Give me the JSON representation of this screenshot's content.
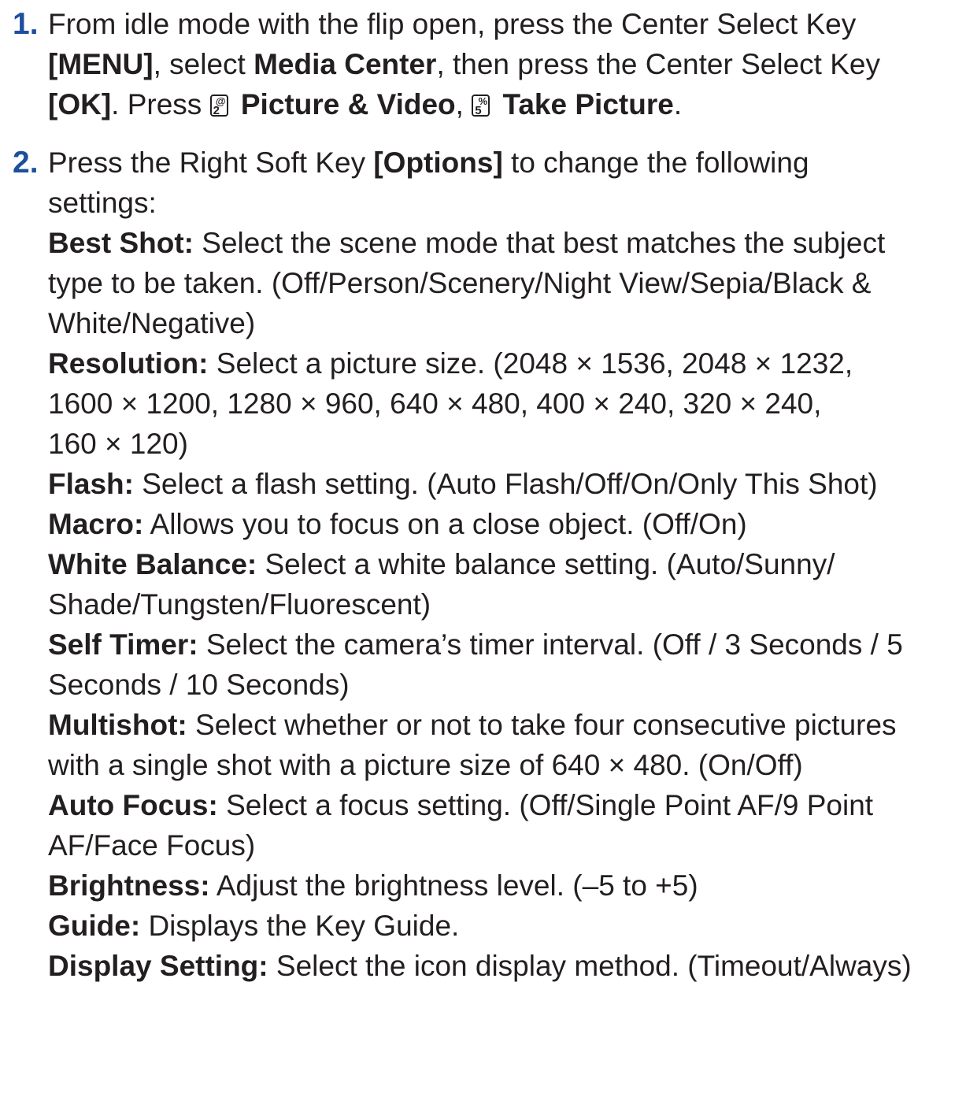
{
  "step1": {
    "number": "1.",
    "l1": "From idle mode with the flip open, press the Center Select Key",
    "l2_b1": "[MENU]",
    "l2_t1": ", select ",
    "l2_b2": "Media Center",
    "l2_t2": ", then press the Center Select Key",
    "l3_b1": "[OK]",
    "l3_t1": ". Press ",
    "key1": {
      "num": "2",
      "sym": "@",
      "icon": "key-2-icon"
    },
    "l3_b2": "Picture & Video",
    "l3_t2": ", ",
    "key2": {
      "num": "5",
      "sym": "%",
      "icon": "key-5-icon"
    },
    "l3_b3": "Take Picture",
    "l3_t3": "."
  },
  "step2": {
    "number": "2.",
    "intro_t1": "Press the Right Soft Key ",
    "intro_b1": "[Options]",
    "intro_t2": " to change the following",
    "intro_t3": "settings:",
    "best_shot": {
      "label": "Best Shot:",
      "l1": " Select the scene mode that best matches the subject",
      "l2": "type to be taken. (Off/Person/Scenery/Night View/Sepia/Black &",
      "l3": "White/Negative)"
    },
    "resolution": {
      "label": "Resolution:",
      "l1": " Select a picture size. (2048 × 1536, 2048 × 1232,",
      "l2": "1600 × 1200, 1280 × 960, 640 × 480, 400 × 240, 320 × 240,",
      "l3": "160 × 120)"
    },
    "flash": {
      "label": "Flash:",
      "l1": " Select a flash setting. (Auto Flash/Off/On/Only This Shot)"
    },
    "macro": {
      "label": "Macro:",
      "l1": " Allows you to focus on a close object. (Off/On)"
    },
    "white_balance": {
      "label": "White Balance:",
      "l1": " Select a white balance setting. (Auto/Sunny/",
      "l2": "Shade/Tungsten/Fluorescent)"
    },
    "self_timer": {
      "label": "Self Timer:",
      "l1": " Select the camera’s timer interval. (Off / 3 Seconds / 5",
      "l2": "Seconds / 10 Seconds)"
    },
    "multishot": {
      "label": "Multishot:",
      "l1": " Select whether or not to take four consecutive pictures",
      "l2": "with a single shot with a picture size of 640 × 480. (On/Off)"
    },
    "auto_focus": {
      "label": "Auto Focus:",
      "l1": " Select a focus setting. (Off/Single Point AF/9 Point",
      "l2": "AF/Face Focus)"
    },
    "brightness": {
      "label": "Brightness:",
      "l1": " Adjust the brightness level. (–5 to +5)"
    },
    "guide": {
      "label": "Guide:",
      "l1": " Displays the Key Guide."
    },
    "display_setting": {
      "label": "Display Setting:",
      "l1": " Select the icon display method. (Timeout/Always)"
    }
  },
  "colors": {
    "step_number": "#1c4f9c",
    "text": "#231f20"
  }
}
